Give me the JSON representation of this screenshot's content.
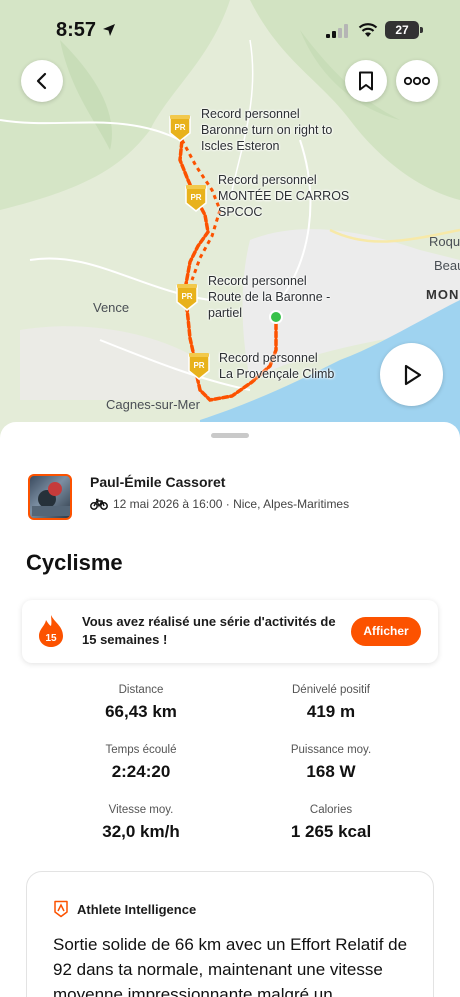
{
  "status_bar": {
    "time": "8:57",
    "battery": "27"
  },
  "map": {
    "place_labels": {
      "vence": "Vence",
      "cagnes": "Cagnes-sur-Mer",
      "roque": "Roqu",
      "beau": "Beau",
      "monaco": "MON"
    },
    "pr_badge": "PR",
    "segments": [
      {
        "title": "Record personnel",
        "name": "Baronne turn on right to Iscles Esteron"
      },
      {
        "title": "Record personnel",
        "name": "MONTÉE DE CARROS SPCOC"
      },
      {
        "title": "Record personnel",
        "name": "Route de la Baronne - partiel"
      },
      {
        "title": "Record personnel",
        "name": "La Provençale Climb"
      }
    ],
    "segment_lines": [
      [
        "Record personnel",
        "Baronne turn on right to",
        "Iscles Esteron"
      ],
      [
        "Record personnel",
        "MONTÉE DE CARROS",
        "SPCOC"
      ],
      [
        "Record personnel",
        "Route de la Baronne -",
        "partiel"
      ],
      [
        "Record personnel",
        "La Provençale Climb"
      ]
    ]
  },
  "athlete": {
    "name": "Paul-Émile Cassoret",
    "meta": "12 mai 2026 à 16:00 · Nice, Alpes-Maritimes"
  },
  "activity": {
    "title": "Cyclisme"
  },
  "streak": {
    "weeks": "15",
    "text": "Vous avez réalisé une série d'activités de 15 semaines !",
    "button": "Afficher"
  },
  "stats": [
    {
      "label": "Distance",
      "value": "66,43 km"
    },
    {
      "label": "Dénivelé positif",
      "value": "419 m"
    },
    {
      "label": "Temps écoulé",
      "value": "2:24:20"
    },
    {
      "label": "Puissance moy.",
      "value": "168 W"
    },
    {
      "label": "Vitesse moy.",
      "value": "32,0 km/h"
    },
    {
      "label": "Calories",
      "value": "1 265 kcal"
    }
  ],
  "athlete_intelligence": {
    "title": "Athlete Intelligence",
    "body": "Sortie solide de 66 km avec un Effort Relatif de 92 dans ta normale, maintenant une vitesse moyenne impressionnante malgré un"
  },
  "colors": {
    "accent": "#fc5200",
    "route": "#fc5200",
    "pr_gold": "#e8b21c",
    "sea": "#9fd3f0"
  }
}
